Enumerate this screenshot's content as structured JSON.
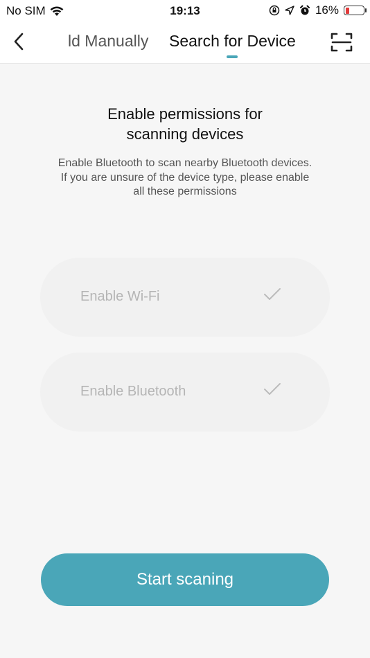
{
  "status_bar": {
    "carrier": "No SIM",
    "time": "19:13",
    "battery_percent": "16%",
    "icons": [
      "wifi-icon",
      "orientation-lock-icon",
      "location-icon",
      "alarm-icon",
      "battery-icon"
    ]
  },
  "nav": {
    "tab_manual": "ld Manually",
    "tab_search": "Search for Device",
    "active_tab": "Search for Device",
    "icons": [
      "back-chevron-icon",
      "scan-qr-icon"
    ]
  },
  "content": {
    "title_line1": "Enable permissions for",
    "title_line2": "scanning devices",
    "desc_line1": "Enable Bluetooth to scan nearby Bluetooth devices.",
    "desc_line2": "If you are unsure of the device type, please enable",
    "desc_line3": "all these permissions"
  },
  "permissions": {
    "wifi_label": "Enable Wi-Fi",
    "bluetooth_label": "Enable Bluetooth"
  },
  "actions": {
    "start_label": "Start scaning"
  },
  "colors": {
    "accent": "#4aa6b8",
    "battery_low": "#e23b3b",
    "background": "#f6f6f6"
  }
}
